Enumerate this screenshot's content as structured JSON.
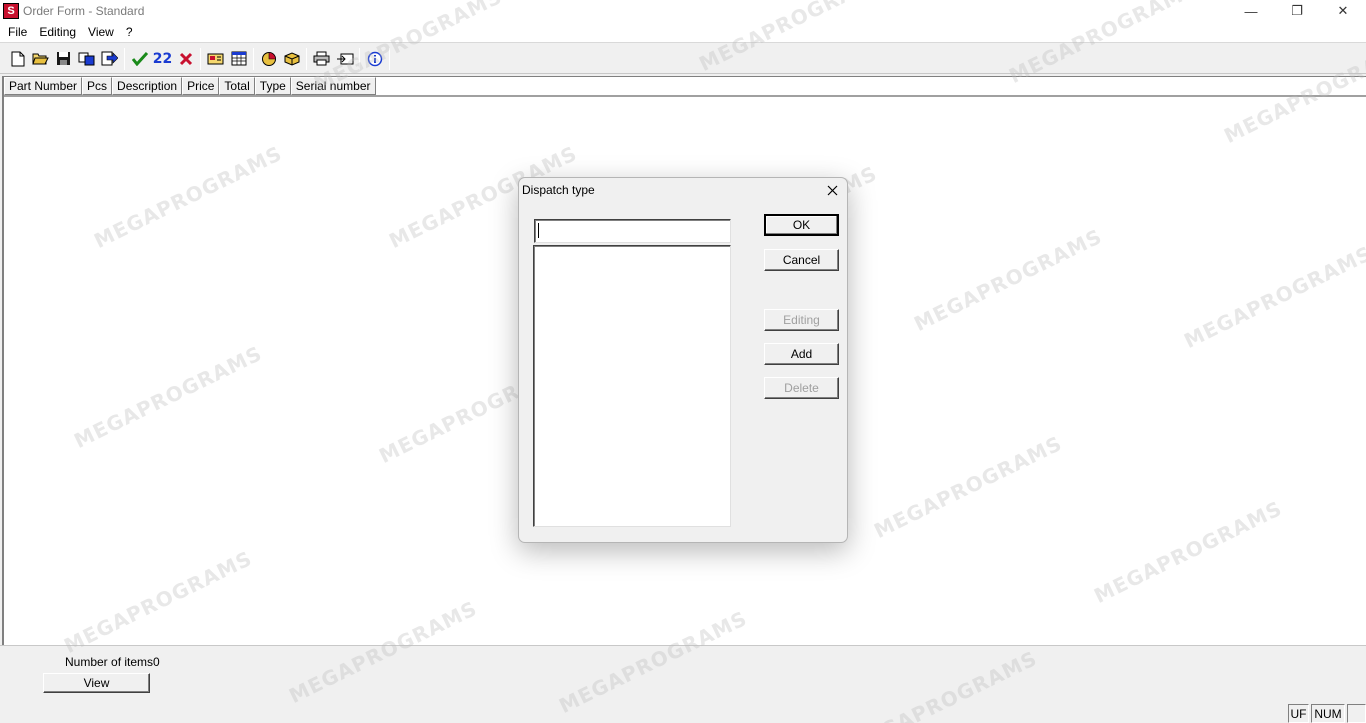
{
  "window": {
    "title": "Order Form - Standard",
    "controls": {
      "minimize": "—",
      "restore": "❐",
      "close": "✕"
    }
  },
  "menu": [
    "File",
    "Editing",
    "View",
    "?"
  ],
  "toolbar": {
    "icons": [
      "new-icon",
      "open-icon",
      "save-icon",
      "export-icon",
      "import-icon",
      "check-icon",
      "numbering-icon",
      "delete-icon",
      "card-icon",
      "table-icon",
      "calculator-icon",
      "package-icon",
      "print-icon",
      "preview-icon",
      "info-icon"
    ],
    "glyph_22": "22"
  },
  "table": {
    "columns": [
      "Part Number",
      "Pcs",
      "Description",
      "Price",
      "Total",
      "Type",
      "Serial number"
    ]
  },
  "footer": {
    "items_label": "Number of items",
    "items_count": "0",
    "view_button": "View"
  },
  "statusbar": {
    "uf": "UF",
    "num": "NUM"
  },
  "watermark": "MEGAPROGRAMS",
  "dialog": {
    "title": "Dispatch type",
    "input_value": "",
    "buttons": {
      "ok": "OK",
      "cancel": "Cancel",
      "editing": "Editing",
      "add": "Add",
      "delete": "Delete"
    }
  },
  "colors": {
    "accent_red": "#c8102e",
    "check_green": "#1a8a1a",
    "info_blue": "#1a3bd1",
    "disabled_text": "#a0a0a0"
  }
}
